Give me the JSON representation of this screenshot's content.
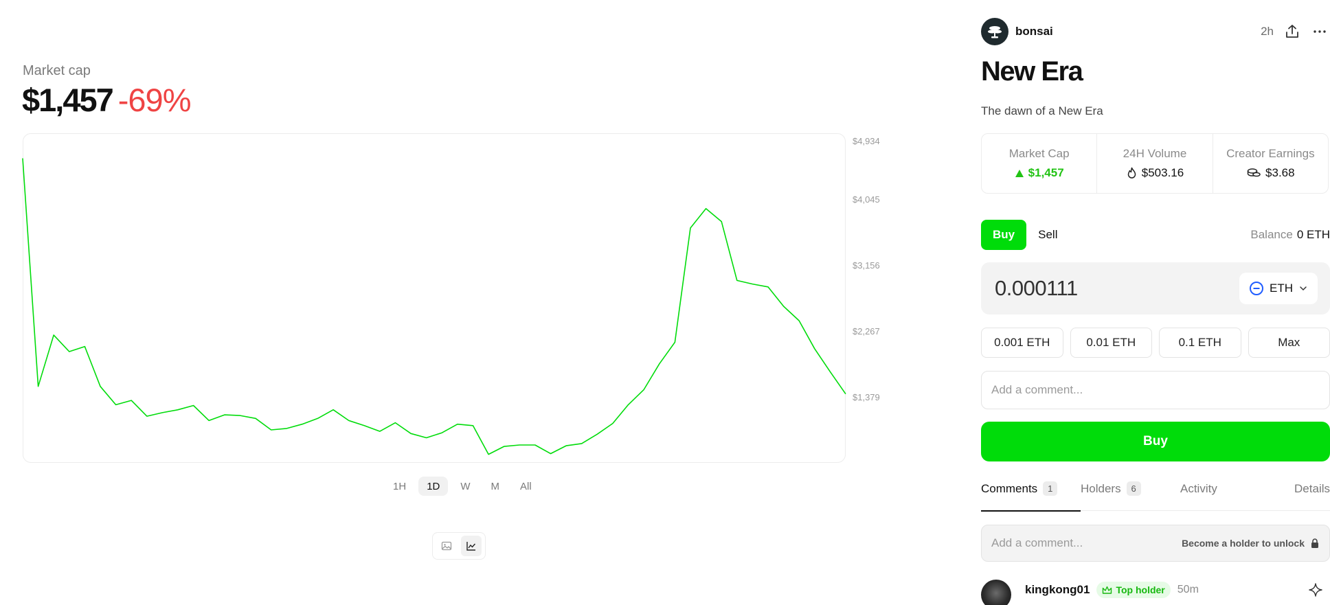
{
  "market": {
    "label": "Market cap",
    "value": "$1,457",
    "change": "-69%"
  },
  "chart_data": {
    "type": "line",
    "color": "#00dc0a",
    "ylim": [
      500,
      5000
    ],
    "ytick_labels": [
      "$4,934",
      "$4,045",
      "$3,156",
      "$2,267",
      "$1,379"
    ],
    "ytick_values": [
      4934,
      4045,
      3156,
      2267,
      1379
    ],
    "series": [
      {
        "values": [
          4700,
          1525,
          2240,
          2010,
          2080,
          1525,
          1270,
          1330,
          1110,
          1160,
          1200,
          1260,
          1050,
          1130,
          1120,
          1080,
          920,
          940,
          1000,
          1080,
          1200,
          1050,
          980,
          900,
          1020,
          870,
          810,
          880,
          1000,
          980,
          580,
          690,
          710,
          710,
          590,
          700,
          730,
          860,
          1010,
          1270,
          1480,
          1840,
          2140,
          3730,
          4000,
          3820,
          3000,
          2950,
          2910,
          2640,
          2440,
          2050,
          1730,
          1420
        ]
      }
    ]
  },
  "timeframes": [
    "1H",
    "1D",
    "W",
    "M",
    "All"
  ],
  "timeframe_active": "1D",
  "post": {
    "author": "bonsai",
    "time": "2h",
    "title": "New Era",
    "description": "The dawn of a New Era"
  },
  "stats": [
    {
      "label": "Market Cap",
      "value": "$1,457",
      "icon": "triangle-up-icon"
    },
    {
      "label": "24H Volume",
      "value": "$503.16",
      "icon": "flame-icon"
    },
    {
      "label": "Creator Earnings",
      "value": "$3.68",
      "icon": "coins-icon"
    }
  ],
  "trade": {
    "buy_label": "Buy",
    "sell_label": "Sell",
    "balance_label": "Balance",
    "balance_value": "0 ETH",
    "amount": "0.000111",
    "currency": "ETH",
    "presets": [
      "0.001 ETH",
      "0.01 ETH",
      "0.1 ETH",
      "Max"
    ],
    "comment_placeholder": "Add a comment...",
    "buy_button": "Buy"
  },
  "sections": {
    "comments": {
      "label": "Comments",
      "count": "1"
    },
    "holders": {
      "label": "Holders",
      "count": "6"
    },
    "activity": "Activity",
    "details": "Details"
  },
  "locked": {
    "placeholder": "Add a comment...",
    "unlock_text": "Become a holder to unlock"
  },
  "comment": {
    "user": "kingkong01",
    "badge": "Top holder",
    "time": "50m"
  }
}
